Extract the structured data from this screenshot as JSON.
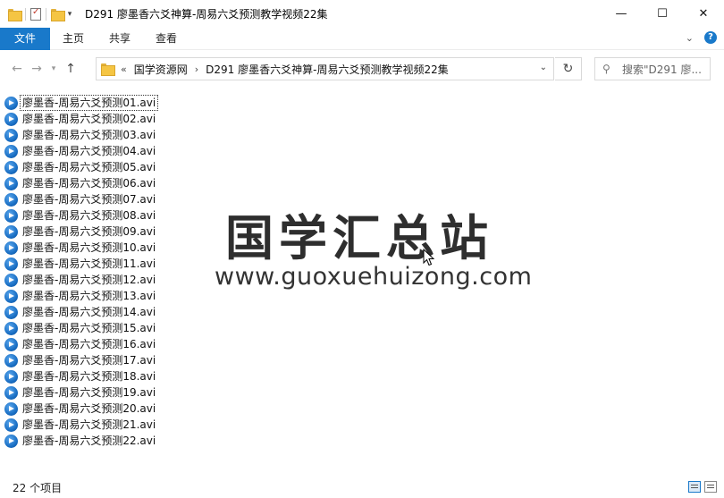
{
  "window": {
    "title": "D291 廖墨香六爻神算-周易六爻预测教学视频22集",
    "minimize_glyph": "—",
    "maximize_glyph": "☐",
    "close_glyph": "✕"
  },
  "ribbon": {
    "tabs": [
      "文件",
      "主页",
      "共享",
      "查看"
    ]
  },
  "address": {
    "overflow": "«",
    "crumbs": [
      "国学资源网",
      "D291 廖墨香六爻神算-周易六爻预测教学视频22集"
    ],
    "search_placeholder": "搜索\"D291 廖..."
  },
  "files": [
    "廖墨香-周易六爻预测01.avi",
    "廖墨香-周易六爻预测02.avi",
    "廖墨香-周易六爻预测03.avi",
    "廖墨香-周易六爻预测04.avi",
    "廖墨香-周易六爻预测05.avi",
    "廖墨香-周易六爻预测06.avi",
    "廖墨香-周易六爻预测07.avi",
    "廖墨香-周易六爻预测08.avi",
    "廖墨香-周易六爻预测09.avi",
    "廖墨香-周易六爻预测10.avi",
    "廖墨香-周易六爻预测11.avi",
    "廖墨香-周易六爻预测12.avi",
    "廖墨香-周易六爻预测13.avi",
    "廖墨香-周易六爻预测14.avi",
    "廖墨香-周易六爻预测15.avi",
    "廖墨香-周易六爻预测16.avi",
    "廖墨香-周易六爻预测17.avi",
    "廖墨香-周易六爻预测18.avi",
    "廖墨香-周易六爻预测19.avi",
    "廖墨香-周易六爻预测20.avi",
    "廖墨香-周易六爻预测21.avi",
    "廖墨香-周易六爻预测22.avi"
  ],
  "watermark": {
    "chinese": "国学汇总站",
    "url": "www.guoxuehuizong.com"
  },
  "status": {
    "item_count": "22 个项目"
  },
  "colors": {
    "accent": "#1979ca"
  }
}
